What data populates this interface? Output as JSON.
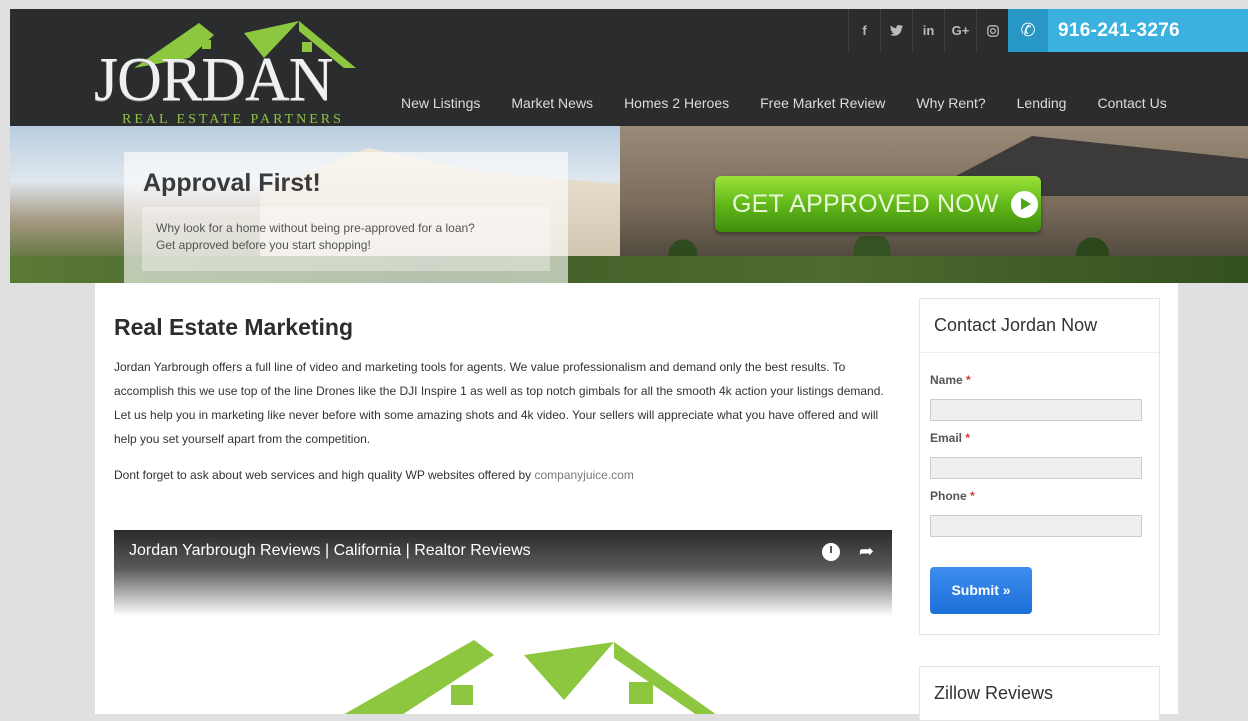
{
  "brand": {
    "name": "JORDAN",
    "tagline": "REAL ESTATE PARTNERS"
  },
  "social": [
    "f",
    "t",
    "in",
    "G+",
    "ig"
  ],
  "phone": "916-241-3276",
  "nav": [
    "New Listings",
    "Market News",
    "Homes 2 Heroes",
    "Free Market Review",
    "Why Rent?",
    "Lending",
    "Contact Us"
  ],
  "hero": {
    "title": "Approval First!",
    "text_line1": "Why look for a home without being pre-approved for a loan?",
    "text_line2": "Get approved before you start shopping!",
    "cta": "GET APPROVED NOW"
  },
  "article": {
    "title": "Real Estate Marketing",
    "paragraph": "Jordan Yarbrough offers a full line of video and marketing tools for agents. We value professionalism and demand only the best results. To accomplish this we use top of the line Drones like the DJI Inspire 1 as well as top notch gimbals for all the smooth 4k action your listings demand.  Let us help you in marketing like never before with some amazing shots and 4k video. Your sellers will appreciate what you have offered and will help you set yourself apart from the competition.",
    "note_prefix": "Dont forget to ask about web services and high quality WP websites offered by ",
    "note_link": "companyjuice.com"
  },
  "video": {
    "title": "Jordan Yarbrough Reviews | California | Realtor Reviews"
  },
  "contact_form": {
    "title": "Contact Jordan Now",
    "name_label": "Name",
    "email_label": "Email",
    "phone_label": "Phone",
    "required_mark": "*",
    "submit": "Submit »"
  },
  "zillow": {
    "title": "Zillow Reviews"
  },
  "colors": {
    "header": "#2a2c2e",
    "phone": "#3ab1de",
    "cta": "#62b81a",
    "brand_green": "#8dc63f",
    "submit": "#1b6fd8"
  }
}
